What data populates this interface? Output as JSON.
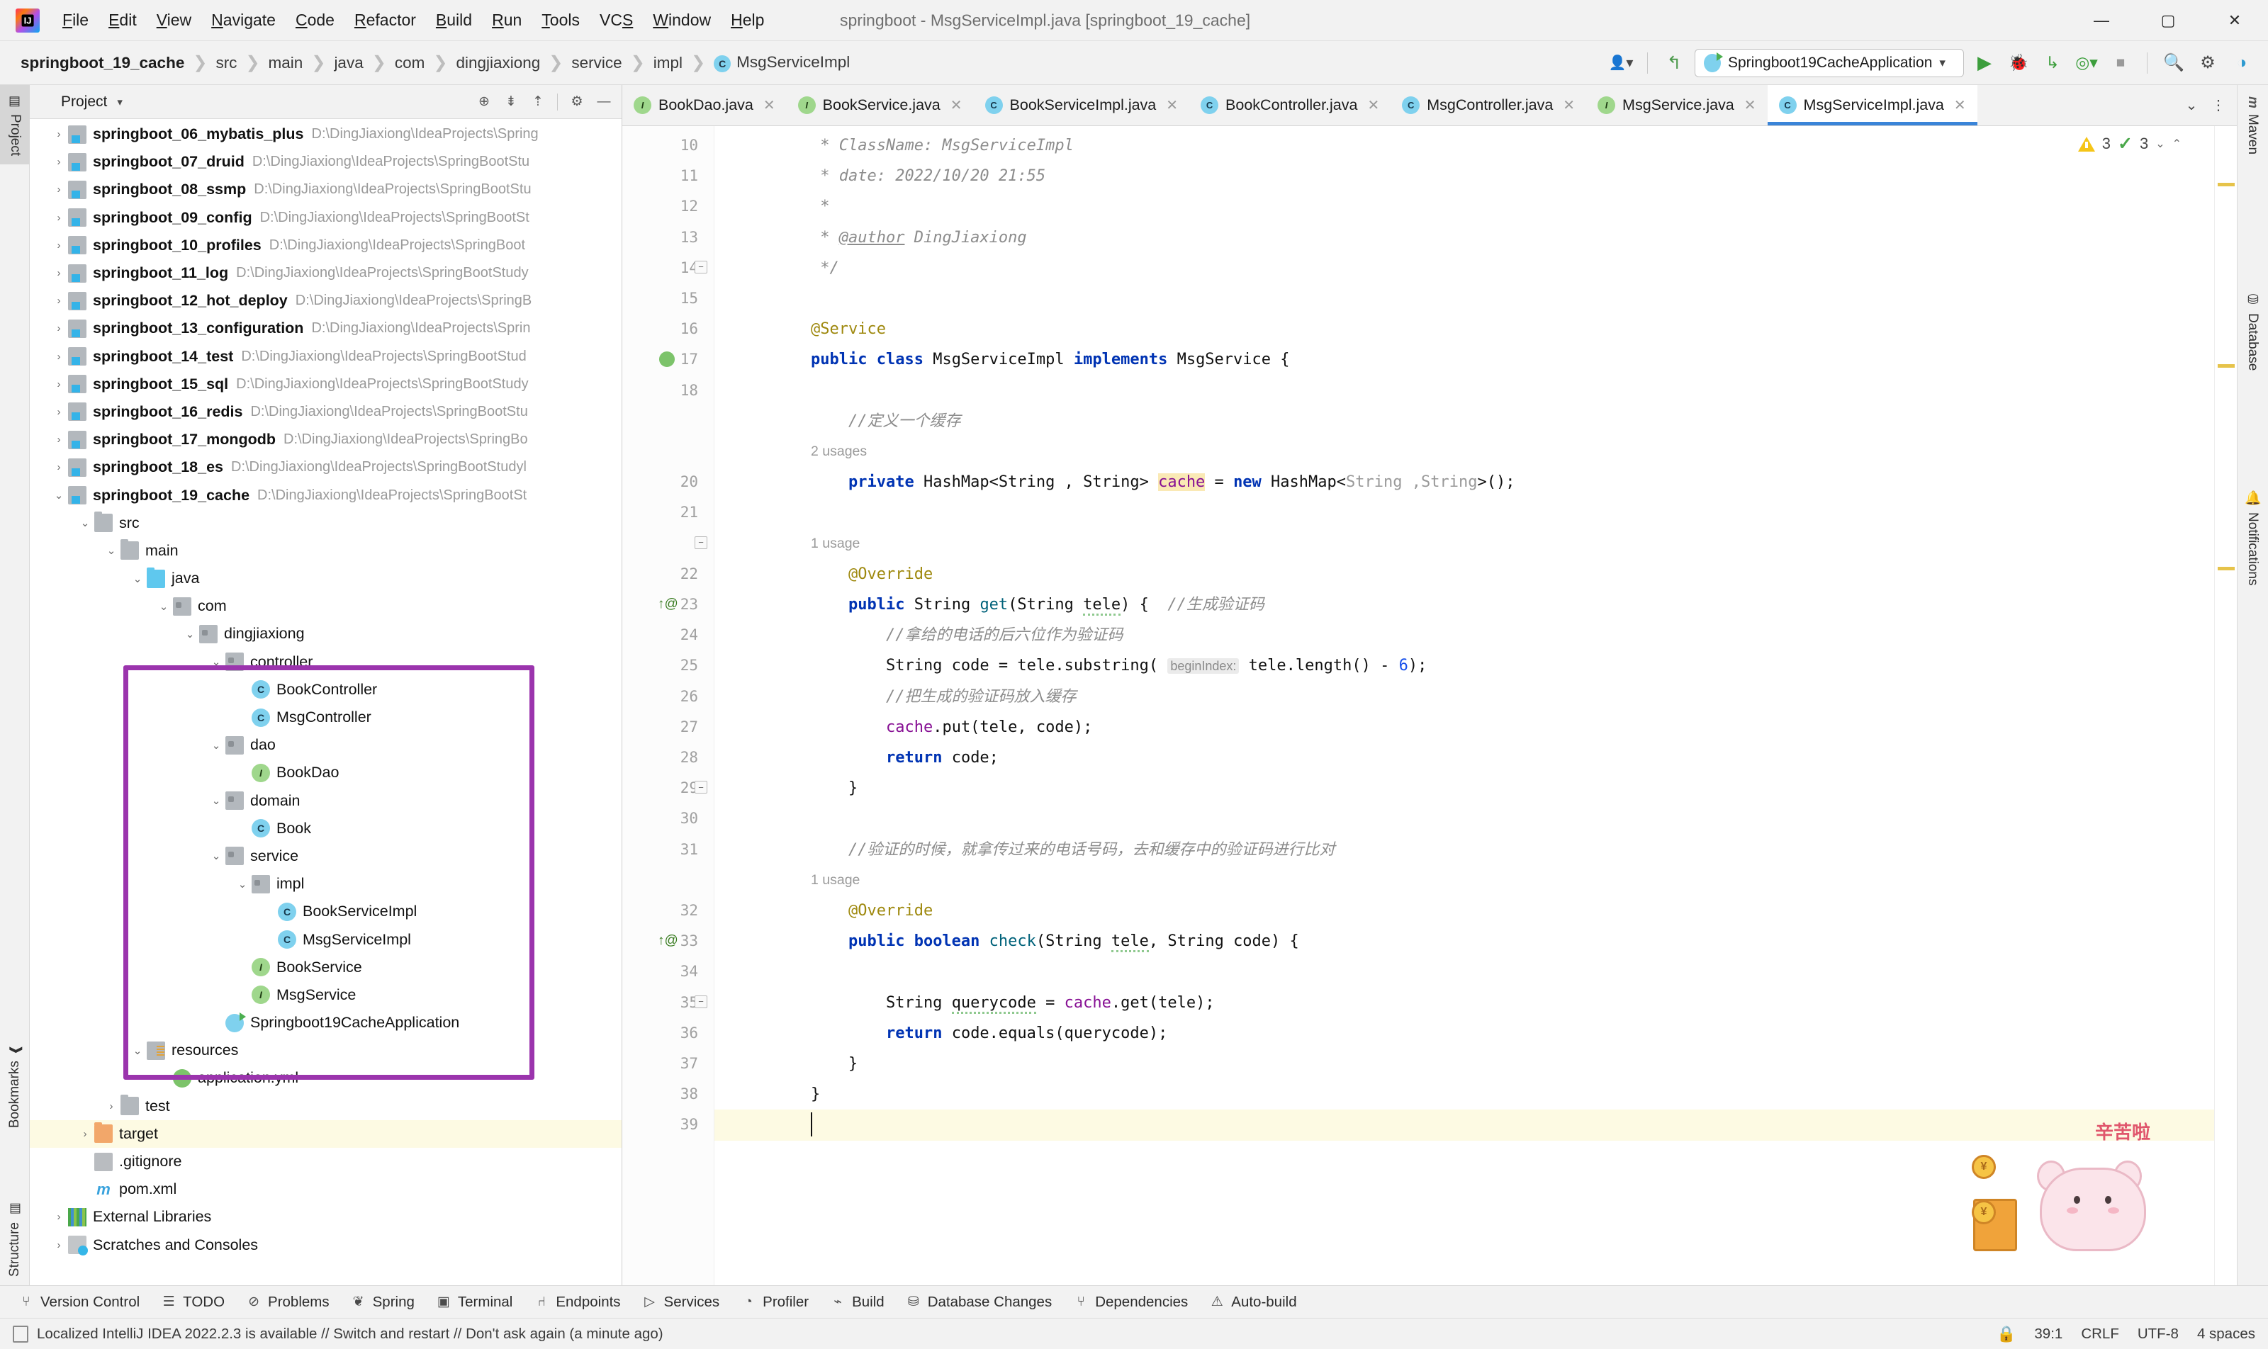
{
  "window": {
    "title": "springboot - MsgServiceImpl.java [springboot_19_cache]",
    "minimize": "—",
    "maximize": "▢",
    "close": "✕",
    "logo": "intellij-idea-logo"
  },
  "menubar": {
    "items": [
      {
        "pre": "",
        "mn": "F",
        "post": "ile"
      },
      {
        "pre": "",
        "mn": "E",
        "post": "dit"
      },
      {
        "pre": "",
        "mn": "V",
        "post": "iew"
      },
      {
        "pre": "",
        "mn": "N",
        "post": "avigate"
      },
      {
        "pre": "",
        "mn": "C",
        "post": "ode"
      },
      {
        "pre": "",
        "mn": "R",
        "post": "efactor"
      },
      {
        "pre": "",
        "mn": "B",
        "post": "uild"
      },
      {
        "pre": "",
        "mn": "R",
        "post": "un"
      },
      {
        "pre": "",
        "mn": "T",
        "post": "ools"
      },
      {
        "pre": "VC",
        "mn": "S",
        "post": ""
      },
      {
        "pre": "",
        "mn": "W",
        "post": "indow"
      },
      {
        "pre": "",
        "mn": "H",
        "post": "elp"
      }
    ]
  },
  "breadcrumb": {
    "separator": "❯",
    "items": [
      "springboot_19_cache",
      "src",
      "main",
      "java",
      "com",
      "dingjiaxiong",
      "service",
      "impl"
    ],
    "file": "MsgServiceImpl",
    "file_icon_letter": "C"
  },
  "toolbar": {
    "run_config": "Springboot19CacheApplication",
    "run_config_caret": "▾",
    "icons": [
      {
        "name": "user-settings-icon",
        "glyph": "👤"
      },
      {
        "name": "update-project-icon",
        "glyph": "↰"
      },
      {
        "name": "run-icon",
        "glyph": "▶"
      },
      {
        "name": "debug-icon",
        "glyph": "🐞"
      },
      {
        "name": "run-with-coverage-icon",
        "glyph": "▷"
      },
      {
        "name": "profiler-icon",
        "glyph": "◎"
      },
      {
        "name": "stop-icon",
        "glyph": "■"
      },
      {
        "name": "search-everywhere-icon",
        "glyph": "🔍"
      },
      {
        "name": "settings-icon",
        "glyph": "⚙"
      }
    ]
  },
  "project_panel": {
    "title": "Project",
    "caret": "▾",
    "tools": [
      {
        "name": "select-opened-file-icon",
        "glyph": "⊕"
      },
      {
        "name": "expand-all-icon",
        "glyph": "⇟"
      },
      {
        "name": "collapse-all-icon",
        "glyph": "⇡"
      },
      {
        "name": "panel-settings-icon",
        "glyph": "⚙"
      },
      {
        "name": "hide-panel-icon",
        "glyph": "—"
      }
    ],
    "tree": [
      {
        "indent": 0,
        "arrow": "›",
        "icon": "f-mod",
        "name": "springboot_06_mybatis_plus",
        "bold": true,
        "path": "D:\\DingJiaxiong\\IdeaProjects\\Spring"
      },
      {
        "indent": 0,
        "arrow": "›",
        "icon": "f-mod",
        "name": "springboot_07_druid",
        "bold": true,
        "path": "D:\\DingJiaxiong\\IdeaProjects\\SpringBootStu"
      },
      {
        "indent": 0,
        "arrow": "›",
        "icon": "f-mod",
        "name": "springboot_08_ssmp",
        "bold": true,
        "path": "D:\\DingJiaxiong\\IdeaProjects\\SpringBootStu"
      },
      {
        "indent": 0,
        "arrow": "›",
        "icon": "f-mod",
        "name": "springboot_09_config",
        "bold": true,
        "path": "D:\\DingJiaxiong\\IdeaProjects\\SpringBootSt"
      },
      {
        "indent": 0,
        "arrow": "›",
        "icon": "f-mod",
        "name": "springboot_10_profiles",
        "bold": true,
        "path": "D:\\DingJiaxiong\\IdeaProjects\\SpringBoot"
      },
      {
        "indent": 0,
        "arrow": "›",
        "icon": "f-mod",
        "name": "springboot_11_log",
        "bold": true,
        "path": "D:\\DingJiaxiong\\IdeaProjects\\SpringBootStudy"
      },
      {
        "indent": 0,
        "arrow": "›",
        "icon": "f-mod",
        "name": "springboot_12_hot_deploy",
        "bold": true,
        "path": "D:\\DingJiaxiong\\IdeaProjects\\SpringB"
      },
      {
        "indent": 0,
        "arrow": "›",
        "icon": "f-mod",
        "name": "springboot_13_configuration",
        "bold": true,
        "path": "D:\\DingJiaxiong\\IdeaProjects\\Sprin"
      },
      {
        "indent": 0,
        "arrow": "›",
        "icon": "f-mod",
        "name": "springboot_14_test",
        "bold": true,
        "path": "D:\\DingJiaxiong\\IdeaProjects\\SpringBootStud"
      },
      {
        "indent": 0,
        "arrow": "›",
        "icon": "f-mod",
        "name": "springboot_15_sql",
        "bold": true,
        "path": "D:\\DingJiaxiong\\IdeaProjects\\SpringBootStudy"
      },
      {
        "indent": 0,
        "arrow": "›",
        "icon": "f-mod",
        "name": "springboot_16_redis",
        "bold": true,
        "path": "D:\\DingJiaxiong\\IdeaProjects\\SpringBootStu"
      },
      {
        "indent": 0,
        "arrow": "›",
        "icon": "f-mod",
        "name": "springboot_17_mongodb",
        "bold": true,
        "path": "D:\\DingJiaxiong\\IdeaProjects\\SpringBo"
      },
      {
        "indent": 0,
        "arrow": "›",
        "icon": "f-mod",
        "name": "springboot_18_es",
        "bold": true,
        "path": "D:\\DingJiaxiong\\IdeaProjects\\SpringBootStudyl"
      },
      {
        "indent": 0,
        "arrow": "⌄",
        "icon": "f-mod",
        "name": "springboot_19_cache",
        "bold": true,
        "path": "D:\\DingJiaxiong\\IdeaProjects\\SpringBootSt"
      },
      {
        "indent": 1,
        "arrow": "⌄",
        "icon": "f-gray",
        "name": "src",
        "bold": false,
        "path": ""
      },
      {
        "indent": 2,
        "arrow": "⌄",
        "icon": "f-gray",
        "name": "main",
        "bold": false,
        "path": ""
      },
      {
        "indent": 3,
        "arrow": "⌄",
        "icon": "f-blue",
        "name": "java",
        "bold": false,
        "path": ""
      },
      {
        "indent": 4,
        "arrow": "⌄",
        "icon": "f-pkg",
        "name": "com",
        "bold": false,
        "path": ""
      },
      {
        "indent": 5,
        "arrow": "⌄",
        "icon": "f-pkg",
        "name": "dingjiaxiong",
        "bold": false,
        "path": ""
      },
      {
        "indent": 6,
        "arrow": "⌄",
        "icon": "f-pkg",
        "name": "controller",
        "bold": false,
        "path": ""
      },
      {
        "indent": 7,
        "arrow": "",
        "icon": "cls",
        "name": "BookController",
        "bold": false,
        "path": ""
      },
      {
        "indent": 7,
        "arrow": "",
        "icon": "cls",
        "name": "MsgController",
        "bold": false,
        "path": ""
      },
      {
        "indent": 6,
        "arrow": "⌄",
        "icon": "f-pkg",
        "name": "dao",
        "bold": false,
        "path": ""
      },
      {
        "indent": 7,
        "arrow": "",
        "icon": "ifc",
        "name": "BookDao",
        "bold": false,
        "path": ""
      },
      {
        "indent": 6,
        "arrow": "⌄",
        "icon": "f-pkg",
        "name": "domain",
        "bold": false,
        "path": ""
      },
      {
        "indent": 7,
        "arrow": "",
        "icon": "cls",
        "name": "Book",
        "bold": false,
        "path": ""
      },
      {
        "indent": 6,
        "arrow": "⌄",
        "icon": "f-pkg",
        "name": "service",
        "bold": false,
        "path": ""
      },
      {
        "indent": 7,
        "arrow": "⌄",
        "icon": "f-pkg",
        "name": "impl",
        "bold": false,
        "path": ""
      },
      {
        "indent": 8,
        "arrow": "",
        "icon": "cls",
        "name": "BookServiceImpl",
        "bold": false,
        "path": ""
      },
      {
        "indent": 8,
        "arrow": "",
        "icon": "cls",
        "name": "MsgServiceImpl",
        "bold": false,
        "path": ""
      },
      {
        "indent": 7,
        "arrow": "",
        "icon": "ifc",
        "name": "BookService",
        "bold": false,
        "path": ""
      },
      {
        "indent": 7,
        "arrow": "",
        "icon": "ifc",
        "name": "MsgService",
        "bold": false,
        "path": ""
      },
      {
        "indent": 6,
        "arrow": "",
        "icon": "spring",
        "name": "Springboot19CacheApplication",
        "bold": false,
        "path": ""
      },
      {
        "indent": 3,
        "arrow": "⌄",
        "icon": "f-res",
        "name": "resources",
        "bold": false,
        "path": ""
      },
      {
        "indent": 4,
        "arrow": "",
        "icon": "yml",
        "name": "application.yml",
        "bold": false,
        "path": ""
      },
      {
        "indent": 2,
        "arrow": "›",
        "icon": "f-gray",
        "name": "test",
        "bold": false,
        "path": ""
      },
      {
        "indent": 1,
        "arrow": "›",
        "icon": "f-orange",
        "name": "target",
        "bold": false,
        "path": "",
        "highlighted": true
      },
      {
        "indent": 1,
        "arrow": "",
        "icon": "git",
        "name": ".gitignore",
        "bold": false,
        "path": ""
      },
      {
        "indent": 1,
        "arrow": "",
        "icon": "mvn",
        "name": "pom.xml",
        "bold": false,
        "path": ""
      },
      {
        "indent": 0,
        "arrow": "›",
        "icon": "lib",
        "name": "External Libraries",
        "bold": false,
        "path": ""
      },
      {
        "indent": 0,
        "arrow": "›",
        "icon": "scr",
        "name": "Scratches and Consoles",
        "bold": false,
        "path": ""
      }
    ]
  },
  "left_strip": {
    "tabs": [
      {
        "label": "Project",
        "icon": "project-icon",
        "active": true
      },
      {
        "label": "Bookmarks",
        "icon": "bookmarks-icon",
        "active": false
      },
      {
        "label": "Structure",
        "icon": "structure-icon",
        "active": false
      }
    ]
  },
  "right_strip": {
    "tabs": [
      {
        "label": "Maven",
        "icon": "maven-icon"
      },
      {
        "label": "Database",
        "icon": "database-icon"
      },
      {
        "label": "Notifications",
        "icon": "notifications-icon"
      }
    ]
  },
  "editor_tabs": {
    "tabs": [
      {
        "label": "BookDao.java",
        "kind": "i",
        "letter": "I",
        "active": false
      },
      {
        "label": "BookService.java",
        "kind": "i",
        "letter": "I",
        "active": false
      },
      {
        "label": "BookServiceImpl.java",
        "kind": "c",
        "letter": "C",
        "active": false
      },
      {
        "label": "BookController.java",
        "kind": "c",
        "letter": "C",
        "active": false
      },
      {
        "label": "MsgController.java",
        "kind": "c",
        "letter": "C",
        "active": false
      },
      {
        "label": "MsgService.java",
        "kind": "i",
        "letter": "I",
        "active": false
      },
      {
        "label": "MsgServiceImpl.java",
        "kind": "c",
        "letter": "C",
        "active": true
      }
    ],
    "close_glyph": "✕",
    "overflow_glyph": "⌄",
    "options_glyph": "⋮"
  },
  "inspections": {
    "warning_count": "3",
    "ok_count": "3",
    "caret": "⌄",
    "collapse": "⌃"
  },
  "code": {
    "first_line_number": 10,
    "lines": [
      {
        "n": 10,
        "html": "<span class='cmt'> * ClassName: MsgServiceImpl</span>"
      },
      {
        "n": 11,
        "html": "<span class='cmt'> * date: 2022/10/20 21:55</span>"
      },
      {
        "n": 12,
        "html": "<span class='cmt'> *</span>"
      },
      {
        "n": 13,
        "html": "<span class='cmt'> * <u>@author</u> DingJiaxiong</span>"
      },
      {
        "n": 14,
        "html": "<span class='cmt'> */</span>"
      },
      {
        "n": 15,
        "html": ""
      },
      {
        "n": 16,
        "html": "<span class='ann'>@Service</span>"
      },
      {
        "n": 17,
        "html": "<span class='k'>public class</span> MsgServiceImpl <span class='k'>implements</span> MsgService {"
      },
      {
        "n": 18,
        "html": ""
      },
      {
        "n": -1,
        "html": "<span class='cmt'>    //定义一个缓存</span>"
      },
      {
        "n": -2,
        "html": "2 usages",
        "hint": true
      },
      {
        "n": 20,
        "html": "    <span class='k'>private</span> HashMap&lt;String , String&gt; <span class='hlcache fld'>cache</span> = <span class='k'>new</span> HashMap&lt;<span class='gray'>String ,String</span>&gt;();"
      },
      {
        "n": 21,
        "html": ""
      },
      {
        "n": -3,
        "html": "1 usage",
        "hint": true
      },
      {
        "n": 22,
        "html": "    <span class='ann'>@Override</span>"
      },
      {
        "n": 23,
        "html": "    <span class='k'>public</span> String <span class='meth'>get</span>(String <span class='squig'>tele</span>) {  <span class='cmt'>//生成验证码</span>"
      },
      {
        "n": 24,
        "html": "        <span class='cmt'>//拿给的电话的后六位作为验证码</span>"
      },
      {
        "n": 25,
        "html": "        String code = tele.substring( <span class='param-hint'>beginIndex:</span> tele.length() - <span class='num'>6</span>);"
      },
      {
        "n": 26,
        "html": "        <span class='cmt'>//把生成的验证码放入缓存</span>"
      },
      {
        "n": 27,
        "html": "        <span class='fld'>cache</span>.put(tele, code);"
      },
      {
        "n": 28,
        "html": "        <span class='k'>return</span> code;"
      },
      {
        "n": 29,
        "html": "    }"
      },
      {
        "n": 30,
        "html": ""
      },
      {
        "n": 31,
        "html": "    <span class='cmt'>//验证的时候，就拿传过来的电话号码，去和缓存中的验证码进行比对</span>"
      },
      {
        "n": -4,
        "html": "1 usage",
        "hint": true
      },
      {
        "n": 32,
        "html": "    <span class='ann'>@Override</span>"
      },
      {
        "n": 33,
        "html": "    <span class='k'>public boolean</span> <span class='meth'>check</span>(String <span class='squig'>tele</span>, String code) {"
      },
      {
        "n": 34,
        "html": ""
      },
      {
        "n": 35,
        "html": "        String <span class='squig'>querycode</span> = <span class='fld'>cache</span>.get(tele);"
      },
      {
        "n": 36,
        "html": "        <span class='k'>return</span> code.equals(querycode);"
      },
      {
        "n": 37,
        "html": "    }"
      },
      {
        "n": 38,
        "html": "}"
      },
      {
        "n": 39,
        "html": "",
        "caret": true
      }
    ]
  },
  "tool_windows": {
    "items": [
      {
        "label": "Version Control",
        "icon": "branch-icon",
        "glyph": "⑂"
      },
      {
        "label": "TODO",
        "icon": "todo-icon",
        "glyph": "☰"
      },
      {
        "label": "Problems",
        "icon": "problems-icon",
        "glyph": "⊘"
      },
      {
        "label": "Spring",
        "icon": "spring-leaf-icon",
        "glyph": "❦"
      },
      {
        "label": "Terminal",
        "icon": "terminal-icon",
        "glyph": "▣"
      },
      {
        "label": "Endpoints",
        "icon": "endpoints-icon",
        "glyph": "⑁"
      },
      {
        "label": "Services",
        "icon": "services-icon",
        "glyph": "▷"
      },
      {
        "label": "Profiler",
        "icon": "profiler-icon",
        "glyph": "◔"
      },
      {
        "label": "Build",
        "icon": "build-hammer-icon",
        "glyph": "⌁"
      },
      {
        "label": "Database Changes",
        "icon": "database-changes-icon",
        "glyph": "⛁"
      },
      {
        "label": "Dependencies",
        "icon": "dependencies-icon",
        "glyph": "⑂"
      },
      {
        "label": "Auto-build",
        "icon": "auto-build-icon",
        "glyph": "⚠"
      }
    ]
  },
  "statusbar": {
    "message": "Localized IntelliJ IDEA 2022.2.3 is available // Switch and restart // Don't ask again (a minute ago)",
    "caret_position": "39:1",
    "line_separator": "CRLF",
    "encoding": "UTF-8",
    "indent": "4 spaces",
    "lock_icon": "lock-icon"
  },
  "mascot": {
    "text": "辛苦啦",
    "coin_text": "¥"
  },
  "colors": {
    "accent": "#3a84d8",
    "highlight_box": "#9b34ad",
    "class_icon": "#7fd1ee",
    "interface_icon": "#9fd78c",
    "warning": "#f5c518",
    "ok": "#4aa84a",
    "caret_row": "#fdfae3"
  }
}
